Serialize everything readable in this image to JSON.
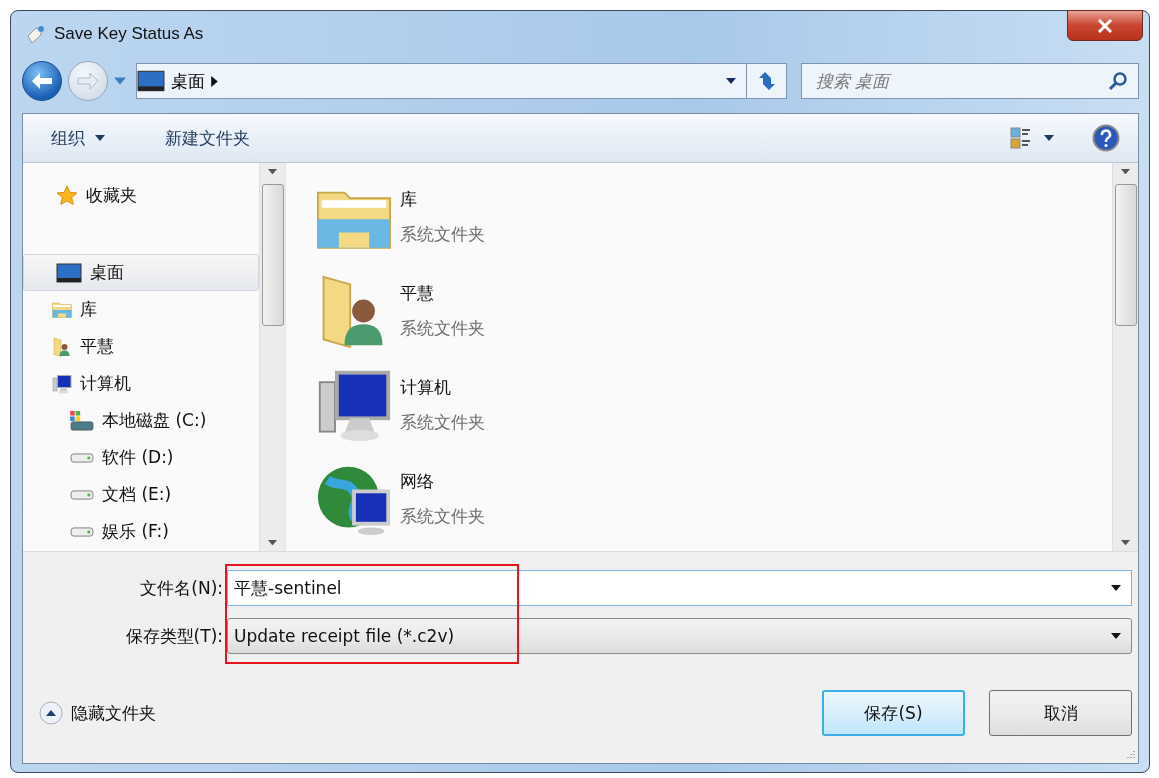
{
  "window": {
    "title": "Save Key Status As"
  },
  "address_bar": {
    "crumbs": [
      "桌面"
    ]
  },
  "search": {
    "placeholder": "搜索 桌面"
  },
  "toolbar": {
    "organize": "组织",
    "new_folder": "新建文件夹"
  },
  "nav": [
    {
      "kind": "star",
      "label": "收藏夹",
      "selected": false
    },
    {
      "kind": "desktop",
      "label": "桌面",
      "selected": true,
      "children": [
        {
          "kind": "library",
          "label": "库",
          "selected": false
        },
        {
          "kind": "user",
          "label": "平慧",
          "selected": false
        },
        {
          "kind": "computer",
          "label": "计算机",
          "selected": false,
          "children": [
            {
              "kind": "windrive",
              "label": "本地磁盘 (C:)",
              "selected": false
            },
            {
              "kind": "drive",
              "label": "软件 (D:)",
              "selected": false
            },
            {
              "kind": "drive",
              "label": "文档 (E:)",
              "selected": false
            },
            {
              "kind": "drive",
              "label": "娱乐 (F:)",
              "selected": false
            }
          ]
        }
      ]
    }
  ],
  "files": [
    {
      "kind": "library",
      "name": "库",
      "type": "系统文件夹"
    },
    {
      "kind": "user",
      "name": "平慧",
      "type": "系统文件夹"
    },
    {
      "kind": "computer",
      "name": "计算机",
      "type": "系统文件夹"
    },
    {
      "kind": "network",
      "name": "网络",
      "type": "系统文件夹"
    }
  ],
  "file_name": {
    "label": "文件名(N):",
    "value": "平慧-sentinel"
  },
  "save_type": {
    "label": "保存类型(T):",
    "value": "Update receipt file (*.c2v)"
  },
  "hide_folders": "隐藏文件夹",
  "buttons": [
    {
      "label": "保存(S)",
      "default": true
    },
    {
      "label": "取消",
      "default": false
    }
  ]
}
